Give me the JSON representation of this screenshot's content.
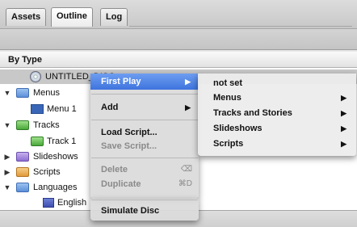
{
  "tabs": [
    {
      "label": "Assets",
      "active": false
    },
    {
      "label": "Outline",
      "active": true
    },
    {
      "label": "Log",
      "active": false
    }
  ],
  "list_header": "By Type",
  "tree": [
    {
      "label": "UNTITLED_DISC",
      "icon": "disc-icon",
      "expanded": null
    },
    {
      "label": "Menus",
      "icon": "folder-icon",
      "expanded": true
    },
    {
      "label": "Menu 1",
      "icon": "menu-icon",
      "expanded": null
    },
    {
      "label": "Tracks",
      "icon": "folder-icon",
      "expanded": true
    },
    {
      "label": "Track 1",
      "icon": "track-icon",
      "expanded": null
    },
    {
      "label": "Slideshows",
      "icon": "folder-icon",
      "expanded": false
    },
    {
      "label": "Scripts",
      "icon": "folder-icon",
      "expanded": false
    },
    {
      "label": "Languages",
      "icon": "folder-icon",
      "expanded": true
    },
    {
      "label": "English",
      "icon": "flag-icon",
      "expanded": null
    }
  ],
  "context_menu": {
    "items": [
      {
        "label": "First Play",
        "submenu": true,
        "enabled": true,
        "highlighted": true
      },
      {
        "label": "Add",
        "submenu": true,
        "enabled": true
      },
      {
        "label": "Load Script...",
        "enabled": true
      },
      {
        "label": "Save Script...",
        "enabled": false
      },
      {
        "label": "Delete",
        "enabled": false,
        "shortcut": "⌫"
      },
      {
        "label": "Duplicate",
        "enabled": false,
        "shortcut": "⌘D"
      },
      {
        "label": "Simulate Disc",
        "enabled": true
      }
    ]
  },
  "submenu": {
    "items": [
      {
        "label": "not set",
        "submenu": false
      },
      {
        "label": "Menus",
        "submenu": true
      },
      {
        "label": "Tracks and Stories",
        "submenu": true
      },
      {
        "label": "Slideshows",
        "submenu": true
      },
      {
        "label": "Scripts",
        "submenu": true
      }
    ]
  },
  "colors": {
    "highlight": "#4a7fe2",
    "selection": "#c8c8c8"
  }
}
